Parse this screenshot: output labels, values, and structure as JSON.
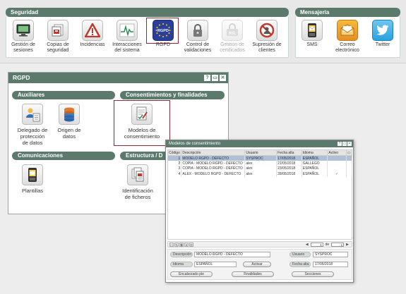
{
  "ribbon": {
    "seguridad_title": "Seguridad",
    "mensajeria_title": "Mensajería",
    "buttons": [
      {
        "label1": "Gestión de",
        "label2": "sesiones",
        "icon": "monitor-icon"
      },
      {
        "label1": "Copias de",
        "label2": "seguridad",
        "icon": "backup-icon"
      },
      {
        "label1": "Incidencias",
        "label2": "",
        "icon": "warning-icon"
      },
      {
        "label1": "Interacciones",
        "label2": "del sistema",
        "icon": "interactions-icon"
      },
      {
        "label1": "RGPD",
        "label2": "",
        "icon": "eu-flag-icon"
      },
      {
        "label1": "Control de",
        "label2": "validaciones",
        "icon": "padlock-icon"
      },
      {
        "label1": "Gestión de",
        "label2": "certificados",
        "icon": "ssl-icon"
      },
      {
        "label1": "Supresión de",
        "label2": "clientes",
        "icon": "no-entry-icon"
      },
      {
        "label1": "SMS",
        "label2": "",
        "icon": "phone-icon"
      },
      {
        "label1": "Correo",
        "label2": "electrónico",
        "icon": "mail-icon"
      },
      {
        "label1": "Twitter",
        "label2": "",
        "icon": "twitter-icon"
      }
    ],
    "rgpd_icon_text": "RGPD",
    "ssl_icon_text": "SSL"
  },
  "panel": {
    "title": "RGPD",
    "title_buttons": [
      "?",
      "▭",
      "✕"
    ],
    "sections": {
      "auxiliares": "Auxiliares",
      "consentimientos": "Consentimientos y finalidades",
      "comunicaciones": "Comunicaciones",
      "estructura": "Estructura / D"
    },
    "items": {
      "delegado": [
        "Delegado de",
        "protección",
        "de datos"
      ],
      "origen": [
        "Origen de",
        "datos"
      ],
      "modelos": [
        "Modelos de",
        "consentimiento"
      ],
      "plantillas": [
        "Plantillas"
      ],
      "identificacion": [
        "Identificación",
        "de ficheros"
      ]
    }
  },
  "modal": {
    "title": "Modelos de consentimiento",
    "columns": [
      "Código",
      "Descripción",
      "Usuario",
      "Fecha alta",
      "Idioma",
      "Activo"
    ],
    "rows": [
      {
        "code": "1",
        "desc": "MODELO RGPD - DEFECTO",
        "user": "SYSPROC",
        "date": "17/05/2018",
        "lang": "ESPAÑOL",
        "active": ""
      },
      {
        "code": "2",
        "desc": "COPIA - MODELO RGPD - DEFECTO",
        "user": "alex",
        "date": "21/05/2018",
        "lang": "GALLEGO",
        "active": ""
      },
      {
        "code": "3",
        "desc": "COPIA - MODELO RGPD - DEFECTO",
        "user": "alex",
        "date": "23/05/2018",
        "lang": "ESPAÑOL",
        "active": ""
      },
      {
        "code": "4",
        "desc": "ALEX - MODELO RGPD - DEFECTO",
        "user": "alex",
        "date": "28/05/2018",
        "lang": "ESPAÑOL",
        "active": "✔"
      }
    ],
    "pager": {
      "page": "1",
      "of_label": "de",
      "total": "1"
    },
    "form": {
      "descripcion_label": "Descripción",
      "descripcion_value": "MODELO RGPD - DEFECTO",
      "usuario_label": "Usuario",
      "usuario_value": "SYSPROC",
      "idioma_label": "Idioma",
      "idioma_value": "ESPAÑOL",
      "activar_label": "Activar",
      "fecha_label": "Fecha alta",
      "fecha_value": "17/05/2018",
      "encabezado_label": "Encabezado pie",
      "finalidades_label": "Finalidades",
      "secciones_label": "Secciones"
    }
  }
}
